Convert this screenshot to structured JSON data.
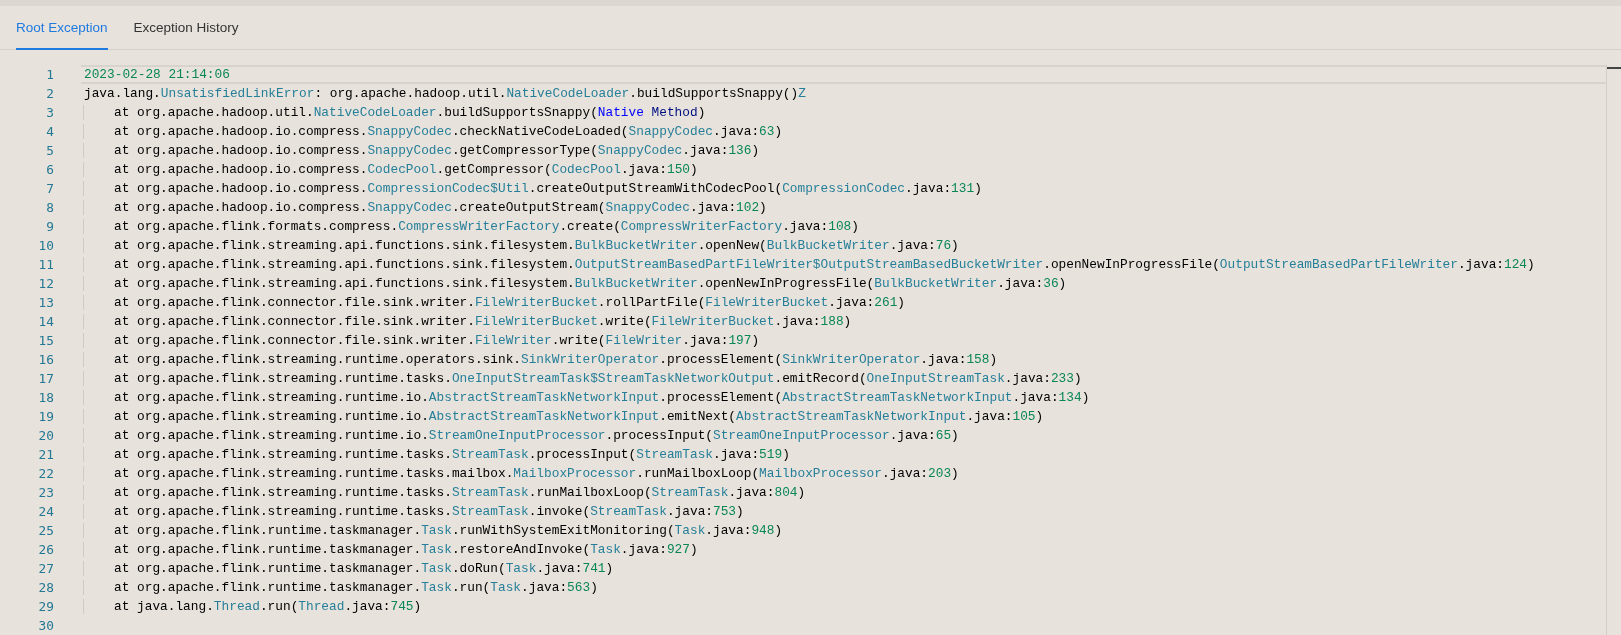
{
  "tabs": [
    {
      "label": "Root Exception",
      "selected": true
    },
    {
      "label": "Exception History",
      "selected": false
    }
  ],
  "editor": {
    "lines": [
      {
        "number": "1",
        "current": true,
        "indented": false,
        "tokens": [
          {
            "kind": "number",
            "text": "2023-02-28 21:14:06"
          }
        ]
      },
      {
        "number": "2",
        "current": false,
        "indented": false,
        "tokens": [
          {
            "kind": "plain",
            "text": "java.lang."
          },
          {
            "kind": "type",
            "text": "UnsatisfiedLinkError"
          },
          {
            "kind": "plain",
            "text": ": org.apache.hadoop.util."
          },
          {
            "kind": "type",
            "text": "NativeCodeLoader"
          },
          {
            "kind": "plain",
            "text": ".buildSupportsSnappy()"
          },
          {
            "kind": "type",
            "text": "Z"
          }
        ]
      },
      {
        "number": "3",
        "current": false,
        "indented": true,
        "tokens": [
          {
            "kind": "plain",
            "text": "at org.apache.hadoop.util."
          },
          {
            "kind": "type",
            "text": "NativeCodeLoader"
          },
          {
            "kind": "plain",
            "text": ".buildSupportsSnappy("
          },
          {
            "kind": "keyword",
            "text": "Native"
          },
          {
            "kind": "variable",
            "text": " Method"
          },
          {
            "kind": "plain",
            "text": ")"
          }
        ]
      },
      {
        "number": "4",
        "current": false,
        "indented": true,
        "tokens": [
          {
            "kind": "plain",
            "text": "at org.apache.hadoop.io.compress."
          },
          {
            "kind": "type",
            "text": "SnappyCodec"
          },
          {
            "kind": "plain",
            "text": ".checkNativeCodeLoaded("
          },
          {
            "kind": "type",
            "text": "SnappyCodec"
          },
          {
            "kind": "plain",
            "text": ".java:"
          },
          {
            "kind": "number",
            "text": "63"
          },
          {
            "kind": "plain",
            "text": ")"
          }
        ]
      },
      {
        "number": "5",
        "current": false,
        "indented": true,
        "tokens": [
          {
            "kind": "plain",
            "text": "at org.apache.hadoop.io.compress."
          },
          {
            "kind": "type",
            "text": "SnappyCodec"
          },
          {
            "kind": "plain",
            "text": ".getCompressorType("
          },
          {
            "kind": "type",
            "text": "SnappyCodec"
          },
          {
            "kind": "plain",
            "text": ".java:"
          },
          {
            "kind": "number",
            "text": "136"
          },
          {
            "kind": "plain",
            "text": ")"
          }
        ]
      },
      {
        "number": "6",
        "current": false,
        "indented": true,
        "tokens": [
          {
            "kind": "plain",
            "text": "at org.apache.hadoop.io.compress."
          },
          {
            "kind": "type",
            "text": "CodecPool"
          },
          {
            "kind": "plain",
            "text": ".getCompressor("
          },
          {
            "kind": "type",
            "text": "CodecPool"
          },
          {
            "kind": "plain",
            "text": ".java:"
          },
          {
            "kind": "number",
            "text": "150"
          },
          {
            "kind": "plain",
            "text": ")"
          }
        ]
      },
      {
        "number": "7",
        "current": false,
        "indented": true,
        "tokens": [
          {
            "kind": "plain",
            "text": "at org.apache.hadoop.io.compress."
          },
          {
            "kind": "type",
            "text": "CompressionCodec$Util"
          },
          {
            "kind": "plain",
            "text": ".createOutputStreamWithCodecPool("
          },
          {
            "kind": "type",
            "text": "CompressionCodec"
          },
          {
            "kind": "plain",
            "text": ".java:"
          },
          {
            "kind": "number",
            "text": "131"
          },
          {
            "kind": "plain",
            "text": ")"
          }
        ]
      },
      {
        "number": "8",
        "current": false,
        "indented": true,
        "tokens": [
          {
            "kind": "plain",
            "text": "at org.apache.hadoop.io.compress."
          },
          {
            "kind": "type",
            "text": "SnappyCodec"
          },
          {
            "kind": "plain",
            "text": ".createOutputStream("
          },
          {
            "kind": "type",
            "text": "SnappyCodec"
          },
          {
            "kind": "plain",
            "text": ".java:"
          },
          {
            "kind": "number",
            "text": "102"
          },
          {
            "kind": "plain",
            "text": ")"
          }
        ]
      },
      {
        "number": "9",
        "current": false,
        "indented": true,
        "tokens": [
          {
            "kind": "plain",
            "text": "at org.apache.flink.formats.compress."
          },
          {
            "kind": "type",
            "text": "CompressWriterFactory"
          },
          {
            "kind": "plain",
            "text": ".create("
          },
          {
            "kind": "type",
            "text": "CompressWriterFactory"
          },
          {
            "kind": "plain",
            "text": ".java:"
          },
          {
            "kind": "number",
            "text": "108"
          },
          {
            "kind": "plain",
            "text": ")"
          }
        ]
      },
      {
        "number": "10",
        "current": false,
        "indented": true,
        "tokens": [
          {
            "kind": "plain",
            "text": "at org.apache.flink.streaming.api.functions.sink.filesystem."
          },
          {
            "kind": "type",
            "text": "BulkBucketWriter"
          },
          {
            "kind": "plain",
            "text": ".openNew("
          },
          {
            "kind": "type",
            "text": "BulkBucketWriter"
          },
          {
            "kind": "plain",
            "text": ".java:"
          },
          {
            "kind": "number",
            "text": "76"
          },
          {
            "kind": "plain",
            "text": ")"
          }
        ]
      },
      {
        "number": "11",
        "current": false,
        "indented": true,
        "tokens": [
          {
            "kind": "plain",
            "text": "at org.apache.flink.streaming.api.functions.sink.filesystem."
          },
          {
            "kind": "type",
            "text": "OutputStreamBasedPartFileWriter$OutputStreamBasedBucketWriter"
          },
          {
            "kind": "plain",
            "text": ".openNewInProgressFile("
          },
          {
            "kind": "type",
            "text": "OutputStreamBasedPartFileWriter"
          },
          {
            "kind": "plain",
            "text": ".java:"
          },
          {
            "kind": "number",
            "text": "124"
          },
          {
            "kind": "plain",
            "text": ")"
          }
        ]
      },
      {
        "number": "12",
        "current": false,
        "indented": true,
        "tokens": [
          {
            "kind": "plain",
            "text": "at org.apache.flink.streaming.api.functions.sink.filesystem."
          },
          {
            "kind": "type",
            "text": "BulkBucketWriter"
          },
          {
            "kind": "plain",
            "text": ".openNewInProgressFile("
          },
          {
            "kind": "type",
            "text": "BulkBucketWriter"
          },
          {
            "kind": "plain",
            "text": ".java:"
          },
          {
            "kind": "number",
            "text": "36"
          },
          {
            "kind": "plain",
            "text": ")"
          }
        ]
      },
      {
        "number": "13",
        "current": false,
        "indented": true,
        "tokens": [
          {
            "kind": "plain",
            "text": "at org.apache.flink.connector.file.sink.writer."
          },
          {
            "kind": "type",
            "text": "FileWriterBucket"
          },
          {
            "kind": "plain",
            "text": ".rollPartFile("
          },
          {
            "kind": "type",
            "text": "FileWriterBucket"
          },
          {
            "kind": "plain",
            "text": ".java:"
          },
          {
            "kind": "number",
            "text": "261"
          },
          {
            "kind": "plain",
            "text": ")"
          }
        ]
      },
      {
        "number": "14",
        "current": false,
        "indented": true,
        "tokens": [
          {
            "kind": "plain",
            "text": "at org.apache.flink.connector.file.sink.writer."
          },
          {
            "kind": "type",
            "text": "FileWriterBucket"
          },
          {
            "kind": "plain",
            "text": ".write("
          },
          {
            "kind": "type",
            "text": "FileWriterBucket"
          },
          {
            "kind": "plain",
            "text": ".java:"
          },
          {
            "kind": "number",
            "text": "188"
          },
          {
            "kind": "plain",
            "text": ")"
          }
        ]
      },
      {
        "number": "15",
        "current": false,
        "indented": true,
        "tokens": [
          {
            "kind": "plain",
            "text": "at org.apache.flink.connector.file.sink.writer."
          },
          {
            "kind": "type",
            "text": "FileWriter"
          },
          {
            "kind": "plain",
            "text": ".write("
          },
          {
            "kind": "type",
            "text": "FileWriter"
          },
          {
            "kind": "plain",
            "text": ".java:"
          },
          {
            "kind": "number",
            "text": "197"
          },
          {
            "kind": "plain",
            "text": ")"
          }
        ]
      },
      {
        "number": "16",
        "current": false,
        "indented": true,
        "tokens": [
          {
            "kind": "plain",
            "text": "at org.apache.flink.streaming.runtime.operators.sink."
          },
          {
            "kind": "type",
            "text": "SinkWriterOperator"
          },
          {
            "kind": "plain",
            "text": ".processElement("
          },
          {
            "kind": "type",
            "text": "SinkWriterOperator"
          },
          {
            "kind": "plain",
            "text": ".java:"
          },
          {
            "kind": "number",
            "text": "158"
          },
          {
            "kind": "plain",
            "text": ")"
          }
        ]
      },
      {
        "number": "17",
        "current": false,
        "indented": true,
        "tokens": [
          {
            "kind": "plain",
            "text": "at org.apache.flink.streaming.runtime.tasks."
          },
          {
            "kind": "type",
            "text": "OneInputStreamTask$StreamTaskNetworkOutput"
          },
          {
            "kind": "plain",
            "text": ".emitRecord("
          },
          {
            "kind": "type",
            "text": "OneInputStreamTask"
          },
          {
            "kind": "plain",
            "text": ".java:"
          },
          {
            "kind": "number",
            "text": "233"
          },
          {
            "kind": "plain",
            "text": ")"
          }
        ]
      },
      {
        "number": "18",
        "current": false,
        "indented": true,
        "tokens": [
          {
            "kind": "plain",
            "text": "at org.apache.flink.streaming.runtime.io."
          },
          {
            "kind": "type",
            "text": "AbstractStreamTaskNetworkInput"
          },
          {
            "kind": "plain",
            "text": ".processElement("
          },
          {
            "kind": "type",
            "text": "AbstractStreamTaskNetworkInput"
          },
          {
            "kind": "plain",
            "text": ".java:"
          },
          {
            "kind": "number",
            "text": "134"
          },
          {
            "kind": "plain",
            "text": ")"
          }
        ]
      },
      {
        "number": "19",
        "current": false,
        "indented": true,
        "tokens": [
          {
            "kind": "plain",
            "text": "at org.apache.flink.streaming.runtime.io."
          },
          {
            "kind": "type",
            "text": "AbstractStreamTaskNetworkInput"
          },
          {
            "kind": "plain",
            "text": ".emitNext("
          },
          {
            "kind": "type",
            "text": "AbstractStreamTaskNetworkInput"
          },
          {
            "kind": "plain",
            "text": ".java:"
          },
          {
            "kind": "number",
            "text": "105"
          },
          {
            "kind": "plain",
            "text": ")"
          }
        ]
      },
      {
        "number": "20",
        "current": false,
        "indented": true,
        "tokens": [
          {
            "kind": "plain",
            "text": "at org.apache.flink.streaming.runtime.io."
          },
          {
            "kind": "type",
            "text": "StreamOneInputProcessor"
          },
          {
            "kind": "plain",
            "text": ".processInput("
          },
          {
            "kind": "type",
            "text": "StreamOneInputProcessor"
          },
          {
            "kind": "plain",
            "text": ".java:"
          },
          {
            "kind": "number",
            "text": "65"
          },
          {
            "kind": "plain",
            "text": ")"
          }
        ]
      },
      {
        "number": "21",
        "current": false,
        "indented": true,
        "tokens": [
          {
            "kind": "plain",
            "text": "at org.apache.flink.streaming.runtime.tasks."
          },
          {
            "kind": "type",
            "text": "StreamTask"
          },
          {
            "kind": "plain",
            "text": ".processInput("
          },
          {
            "kind": "type",
            "text": "StreamTask"
          },
          {
            "kind": "plain",
            "text": ".java:"
          },
          {
            "kind": "number",
            "text": "519"
          },
          {
            "kind": "plain",
            "text": ")"
          }
        ]
      },
      {
        "number": "22",
        "current": false,
        "indented": true,
        "tokens": [
          {
            "kind": "plain",
            "text": "at org.apache.flink.streaming.runtime.tasks.mailbox."
          },
          {
            "kind": "type",
            "text": "MailboxProcessor"
          },
          {
            "kind": "plain",
            "text": ".runMailboxLoop("
          },
          {
            "kind": "type",
            "text": "MailboxProcessor"
          },
          {
            "kind": "plain",
            "text": ".java:"
          },
          {
            "kind": "number",
            "text": "203"
          },
          {
            "kind": "plain",
            "text": ")"
          }
        ]
      },
      {
        "number": "23",
        "current": false,
        "indented": true,
        "tokens": [
          {
            "kind": "plain",
            "text": "at org.apache.flink.streaming.runtime.tasks."
          },
          {
            "kind": "type",
            "text": "StreamTask"
          },
          {
            "kind": "plain",
            "text": ".runMailboxLoop("
          },
          {
            "kind": "type",
            "text": "StreamTask"
          },
          {
            "kind": "plain",
            "text": ".java:"
          },
          {
            "kind": "number",
            "text": "804"
          },
          {
            "kind": "plain",
            "text": ")"
          }
        ]
      },
      {
        "number": "24",
        "current": false,
        "indented": true,
        "tokens": [
          {
            "kind": "plain",
            "text": "at org.apache.flink.streaming.runtime.tasks."
          },
          {
            "kind": "type",
            "text": "StreamTask"
          },
          {
            "kind": "plain",
            "text": ".invoke("
          },
          {
            "kind": "type",
            "text": "StreamTask"
          },
          {
            "kind": "plain",
            "text": ".java:"
          },
          {
            "kind": "number",
            "text": "753"
          },
          {
            "kind": "plain",
            "text": ")"
          }
        ]
      },
      {
        "number": "25",
        "current": false,
        "indented": true,
        "tokens": [
          {
            "kind": "plain",
            "text": "at org.apache.flink.runtime.taskmanager."
          },
          {
            "kind": "type",
            "text": "Task"
          },
          {
            "kind": "plain",
            "text": ".runWithSystemExitMonitoring("
          },
          {
            "kind": "type",
            "text": "Task"
          },
          {
            "kind": "plain",
            "text": ".java:"
          },
          {
            "kind": "number",
            "text": "948"
          },
          {
            "kind": "plain",
            "text": ")"
          }
        ]
      },
      {
        "number": "26",
        "current": false,
        "indented": true,
        "tokens": [
          {
            "kind": "plain",
            "text": "at org.apache.flink.runtime.taskmanager."
          },
          {
            "kind": "type",
            "text": "Task"
          },
          {
            "kind": "plain",
            "text": ".restoreAndInvoke("
          },
          {
            "kind": "type",
            "text": "Task"
          },
          {
            "kind": "plain",
            "text": ".java:"
          },
          {
            "kind": "number",
            "text": "927"
          },
          {
            "kind": "plain",
            "text": ")"
          }
        ]
      },
      {
        "number": "27",
        "current": false,
        "indented": true,
        "tokens": [
          {
            "kind": "plain",
            "text": "at org.apache.flink.runtime.taskmanager."
          },
          {
            "kind": "type",
            "text": "Task"
          },
          {
            "kind": "plain",
            "text": ".doRun("
          },
          {
            "kind": "type",
            "text": "Task"
          },
          {
            "kind": "plain",
            "text": ".java:"
          },
          {
            "kind": "number",
            "text": "741"
          },
          {
            "kind": "plain",
            "text": ")"
          }
        ]
      },
      {
        "number": "28",
        "current": false,
        "indented": true,
        "tokens": [
          {
            "kind": "plain",
            "text": "at org.apache.flink.runtime.taskmanager."
          },
          {
            "kind": "type",
            "text": "Task"
          },
          {
            "kind": "plain",
            "text": ".run("
          },
          {
            "kind": "type",
            "text": "Task"
          },
          {
            "kind": "plain",
            "text": ".java:"
          },
          {
            "kind": "number",
            "text": "563"
          },
          {
            "kind": "plain",
            "text": ")"
          }
        ]
      },
      {
        "number": "29",
        "current": false,
        "indented": true,
        "tokens": [
          {
            "kind": "plain",
            "text": "at java.lang."
          },
          {
            "kind": "type",
            "text": "Thread"
          },
          {
            "kind": "plain",
            "text": ".run("
          },
          {
            "kind": "type",
            "text": "Thread"
          },
          {
            "kind": "plain",
            "text": ".java:"
          },
          {
            "kind": "number",
            "text": "745"
          },
          {
            "kind": "plain",
            "text": ")"
          }
        ]
      },
      {
        "number": "30",
        "current": false,
        "indented": false
      }
    ]
  }
}
